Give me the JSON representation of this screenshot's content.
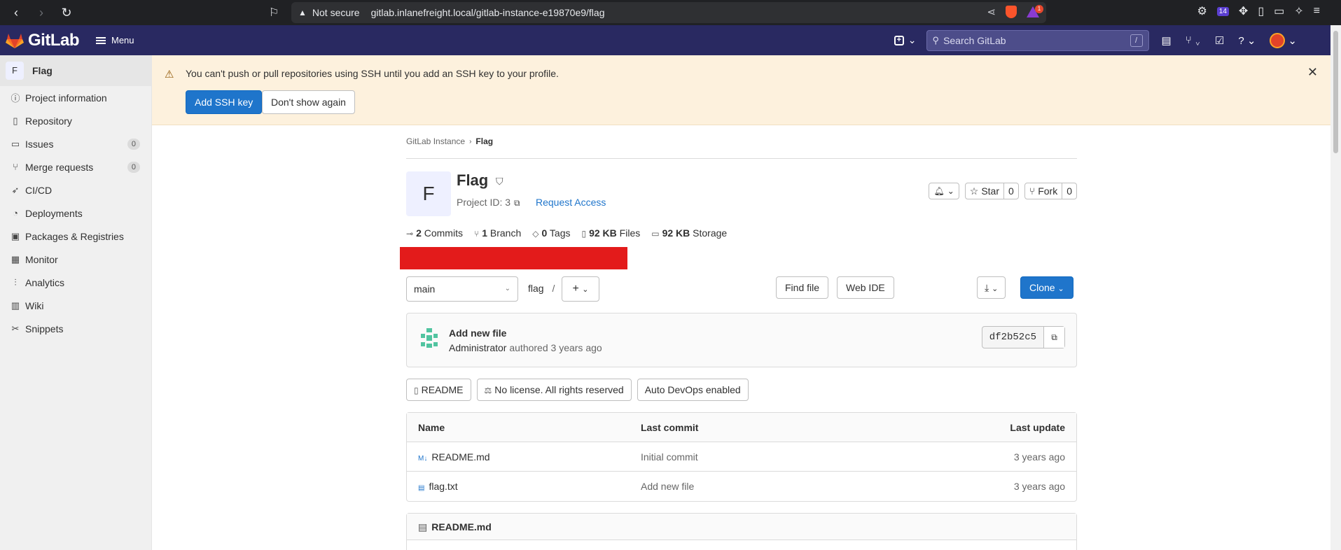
{
  "browser": {
    "url_warning": "Not secure",
    "url": "gitlab.inlanefreight.local/gitlab-instance-e19870e9/flag",
    "extension_count": "14",
    "rewards_badge": "1"
  },
  "header": {
    "logo_text": "GitLab",
    "menu_label": "Menu",
    "search_placeholder": "Search GitLab",
    "search_shortcut": "/",
    "brand_color": "#292961"
  },
  "sidebar": {
    "project_initial": "F",
    "project_name": "Flag",
    "items": [
      {
        "label": "Project information",
        "icon": "info-icon"
      },
      {
        "label": "Repository",
        "icon": "book-icon"
      },
      {
        "label": "Issues",
        "icon": "issues-icon",
        "count": "0"
      },
      {
        "label": "Merge requests",
        "icon": "merge-request-icon",
        "count": "0"
      },
      {
        "label": "CI/CD",
        "icon": "rocket-icon"
      },
      {
        "label": "Deployments",
        "icon": "deployments-icon"
      },
      {
        "label": "Packages & Registries",
        "icon": "package-icon"
      },
      {
        "label": "Monitor",
        "icon": "monitor-icon"
      },
      {
        "label": "Analytics",
        "icon": "chart-icon"
      },
      {
        "label": "Wiki",
        "icon": "wiki-icon"
      },
      {
        "label": "Snippets",
        "icon": "snippet-icon"
      }
    ]
  },
  "banner": {
    "message": "You can't push or pull repositories using SSH until you add an SSH key to your profile.",
    "add_ssh_key": "Add SSH key",
    "dont_show": "Don't show again"
  },
  "breadcrumb": {
    "parent": "GitLab Instance",
    "current": "Flag"
  },
  "project": {
    "initial": "F",
    "name": "Flag",
    "id_label": "Project ID: 3",
    "request_access": "Request Access",
    "star_label": "Star",
    "star_count": "0",
    "fork_label": "Fork",
    "fork_count": "0"
  },
  "stats": {
    "commits_num": "2",
    "commits_label": "Commits",
    "branch_num": "1",
    "branch_label": "Branch",
    "tags_num": "0",
    "tags_label": "Tags",
    "files_num": "92 KB",
    "files_label": "Files",
    "storage_num": "92 KB",
    "storage_label": "Storage"
  },
  "tree": {
    "branch": "main",
    "path": "flag",
    "path_sep": "/",
    "find_file": "Find file",
    "web_ide": "Web IDE",
    "clone": "Clone"
  },
  "last_commit": {
    "title": "Add new file",
    "author": "Administrator",
    "meta": "authored 3 years ago",
    "sha": "df2b52c5"
  },
  "badges": {
    "readme": "README",
    "license": "No license. All rights reserved",
    "autodevops": "Auto DevOps enabled"
  },
  "files": {
    "headers": {
      "name": "Name",
      "commit": "Last commit",
      "update": "Last update"
    },
    "rows": [
      {
        "name": "README.md",
        "commit": "Initial commit",
        "update": "3 years ago",
        "icon": "markdown-icon"
      },
      {
        "name": "flag.txt",
        "commit": "Add new file",
        "update": "3 years ago",
        "icon": "file-icon"
      }
    ]
  },
  "readme": {
    "title": "README.md"
  }
}
